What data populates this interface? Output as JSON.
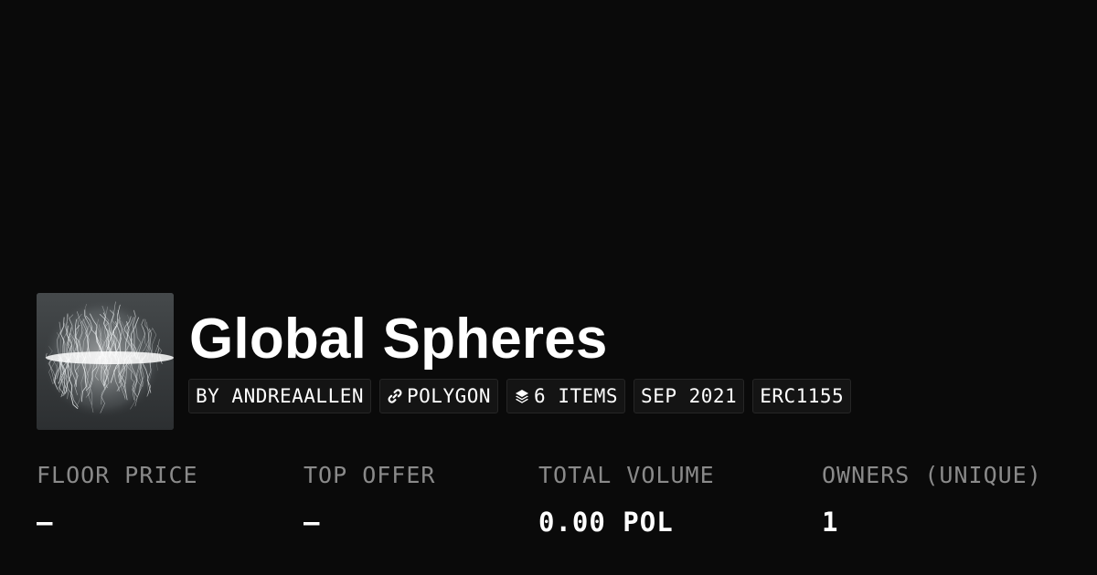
{
  "collection": {
    "name": "Global Spheres",
    "thumbnail_icon": "white-filament-sphere-artwork"
  },
  "chips": {
    "creator": "BY ANDREAALLEN",
    "chain": "POLYGON",
    "chain_icon": "link-icon",
    "items": "6 ITEMS",
    "items_icon": "layers-icon",
    "date": "SEP 2021",
    "standard": "ERC1155"
  },
  "stats": {
    "floor_price": {
      "label": "FLOOR PRICE",
      "value": "–"
    },
    "top_offer": {
      "label": "TOP OFFER",
      "value": "–"
    },
    "total_volume": {
      "label": "TOTAL VOLUME",
      "value": "0.00 POL"
    },
    "owners": {
      "label": "OWNERS (UNIQUE)",
      "value": "1"
    }
  },
  "colors": {
    "background": "#0a0a0a",
    "text_primary": "#ffffff",
    "text_muted": "#8a8a8a",
    "chip_background": "#141414"
  }
}
